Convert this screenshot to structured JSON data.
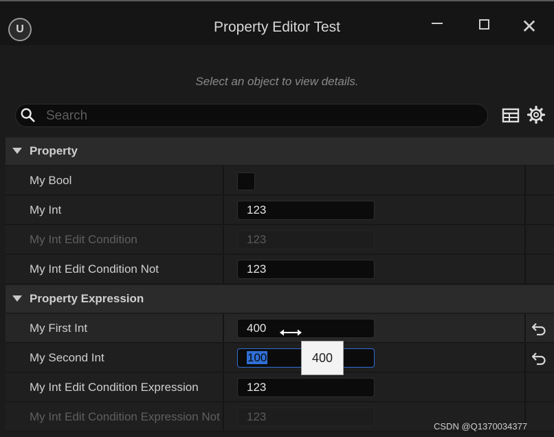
{
  "window": {
    "title": "Property Editor Test",
    "logo_text": "U",
    "close_glyph": "✕"
  },
  "details": {
    "empty_message": "Select an object to view details.",
    "search_placeholder": "Search"
  },
  "categories": [
    {
      "label": "Property",
      "rows": [
        {
          "name": "My Bool",
          "type": "checkbox",
          "checked": false
        },
        {
          "name": "My Int",
          "type": "int",
          "value": "123"
        },
        {
          "name": "My Int Edit Condition",
          "type": "int",
          "value": "123",
          "disabled": true
        },
        {
          "name": "My Int Edit Condition Not",
          "type": "int",
          "value": "123"
        }
      ]
    },
    {
      "label": "Property Expression",
      "rows": [
        {
          "name": "My First Int",
          "type": "int",
          "value": "400",
          "reset": true,
          "hover": true
        },
        {
          "name": "My Second Int",
          "type": "int",
          "value": "100",
          "reset": true,
          "editing": true,
          "selected": true
        },
        {
          "name": "My Int Edit Condition Expression",
          "type": "int",
          "value": "123"
        },
        {
          "name": "My Int Edit Condition Expression Not",
          "type": "int",
          "value": "123",
          "disabled": true
        }
      ]
    }
  ],
  "tooltip": {
    "value": "400"
  },
  "watermark": "CSDN @Q1370034377",
  "colors": {
    "selection": "#2f6fd6",
    "background": "#1b1b1b",
    "category": "#2b2b2b"
  },
  "icons": [
    "unreal-logo-icon",
    "minimize-icon",
    "maximize-icon",
    "close-icon",
    "search-icon",
    "table-view-icon",
    "settings-gear-icon",
    "triangle-down-icon",
    "reset-to-default-icon",
    "horizontal-drag-cursor-icon"
  ]
}
